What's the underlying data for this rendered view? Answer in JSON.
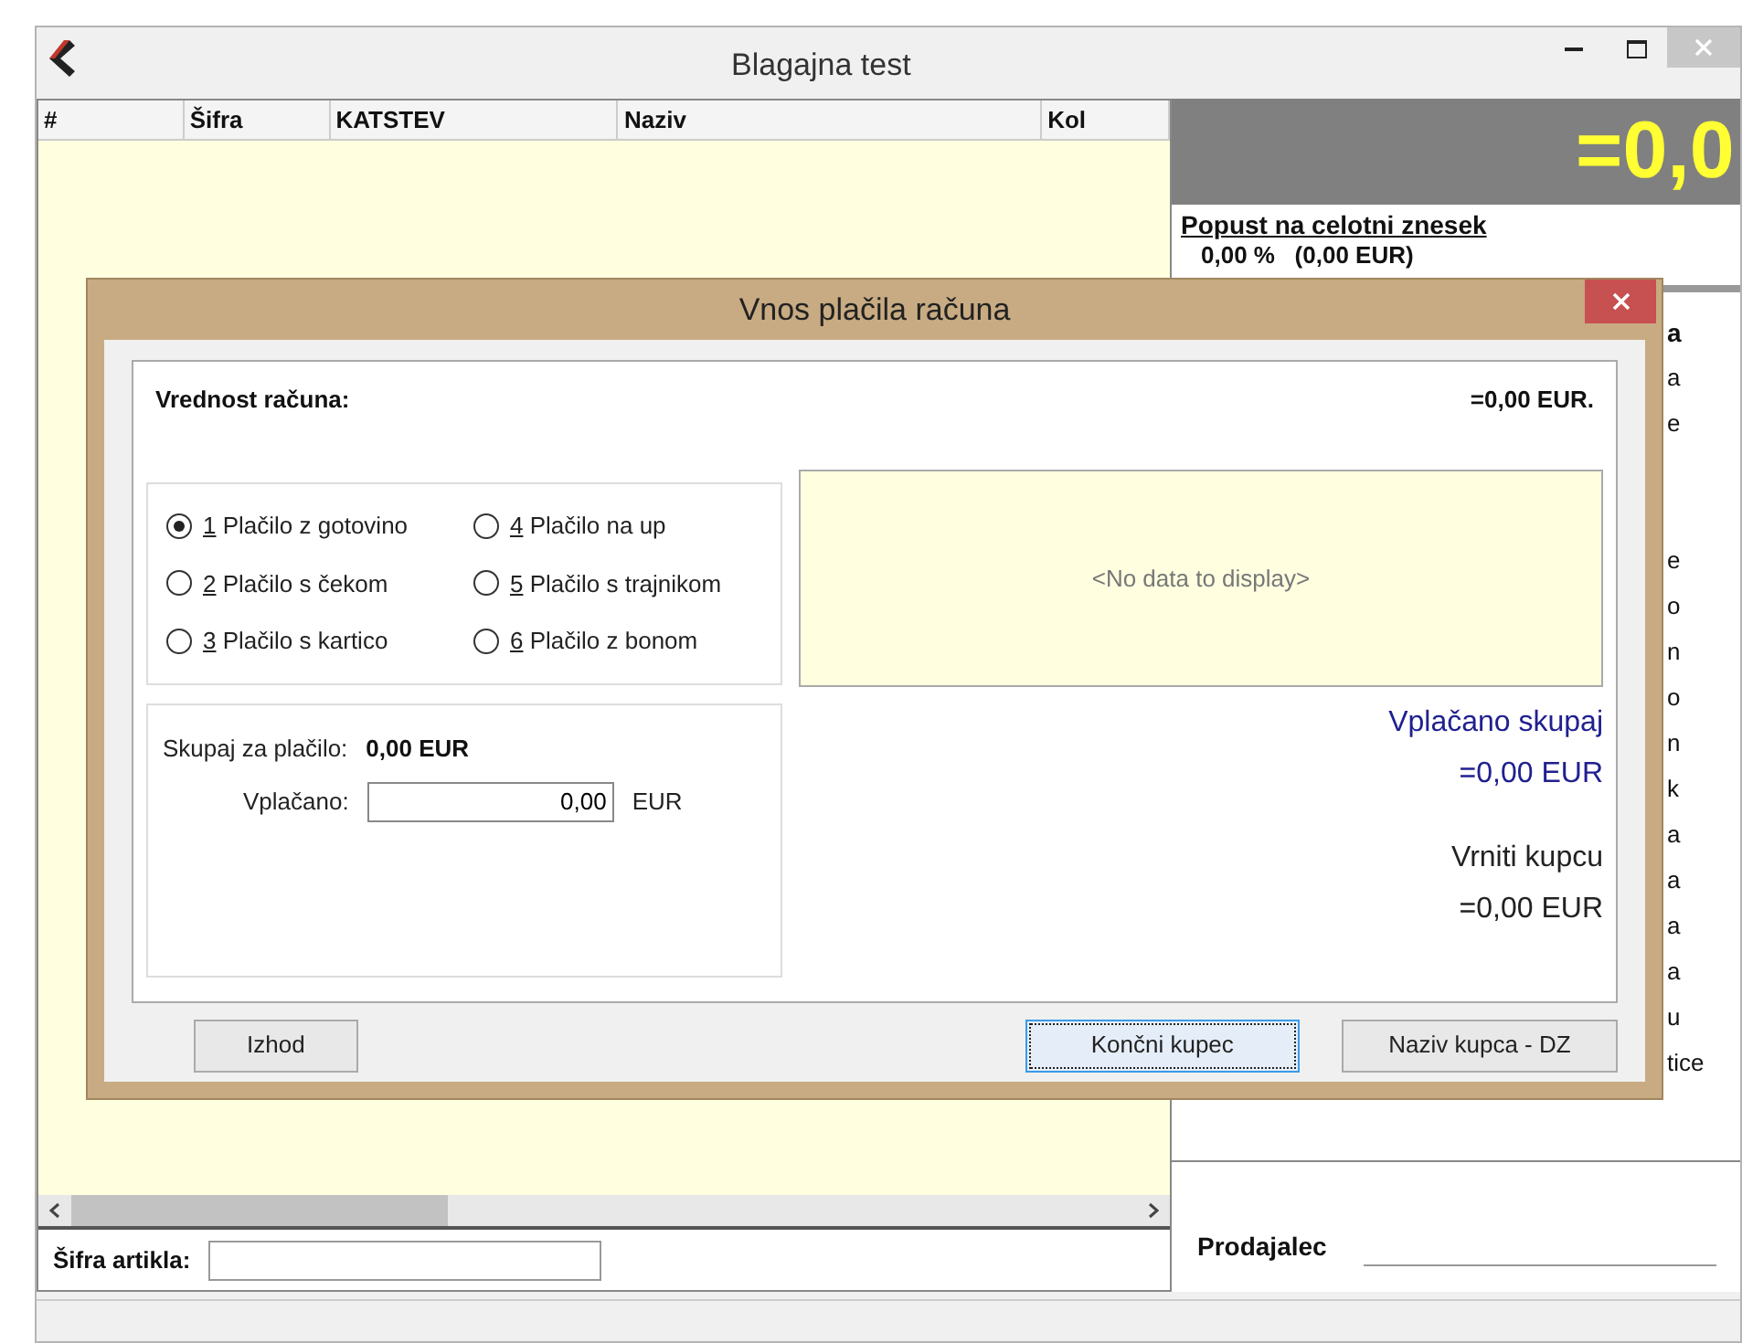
{
  "window": {
    "title": "Blagajna test"
  },
  "table": {
    "columns": [
      "#",
      "Šifra",
      "KATSTEV",
      "Naziv",
      "Kol"
    ]
  },
  "article_code": {
    "label": "Šifra artikla:"
  },
  "total_display": "=0,0",
  "discount": {
    "title": "Popust na celotni znesek",
    "value": "0,00 %   (0,00 EUR)"
  },
  "side_fragments": [
    {
      "text": "a",
      "kind": "heading"
    },
    {
      "text": "a",
      "kind": "text"
    },
    {
      "text": "e",
      "kind": "text"
    },
    {
      "kind": "gap"
    },
    {
      "text": "e",
      "kind": "text"
    },
    {
      "text": "o",
      "kind": "text"
    },
    {
      "text": "n",
      "kind": "text"
    },
    {
      "text": "o",
      "kind": "text"
    },
    {
      "text": "n",
      "kind": "text"
    },
    {
      "text": "k",
      "kind": "text"
    },
    {
      "text": "a",
      "kind": "text"
    },
    {
      "text": "a",
      "kind": "text"
    },
    {
      "text": "a",
      "kind": "text"
    },
    {
      "text": "a",
      "kind": "text"
    },
    {
      "text": "u",
      "kind": "text"
    },
    {
      "text": "tice",
      "kind": "text"
    }
  ],
  "seller": {
    "label": "Prodajalec"
  },
  "dialog": {
    "title": "Vnos plačila računa",
    "invoice_label": "Vrednost računa:",
    "invoice_value": "=0,00 EUR.",
    "payment_methods": [
      {
        "key": "1",
        "label": "Plačilo z gotovino",
        "selected": true
      },
      {
        "key": "2",
        "label": "Plačilo s čekom",
        "selected": false
      },
      {
        "key": "3",
        "label": "Plačilo s kartico",
        "selected": false
      },
      {
        "key": "4",
        "label": "Plačilo na up",
        "selected": false
      },
      {
        "key": "5",
        "label": "Plačilo s trajnikom",
        "selected": false
      },
      {
        "key": "6",
        "label": "Plačilo z bonom",
        "selected": false
      }
    ],
    "no_data": "<No data to display>",
    "total_label": "Skupaj za plačilo:",
    "total_value": "0,00 EUR",
    "paid_label": "Vplačano:",
    "paid_value": "0,00",
    "paid_unit": "EUR",
    "paid_total_label": "Vplačano skupaj",
    "paid_total_value": "=0,00 EUR",
    "change_label": "Vrniti kupcu",
    "change_value": "=0,00 EUR",
    "buttons": [
      {
        "label": "Izhod",
        "focused": false
      },
      {
        "label": "Končni kupec",
        "focused": true
      },
      {
        "label": "Naziv kupca - DZ",
        "focused": false
      }
    ]
  }
}
